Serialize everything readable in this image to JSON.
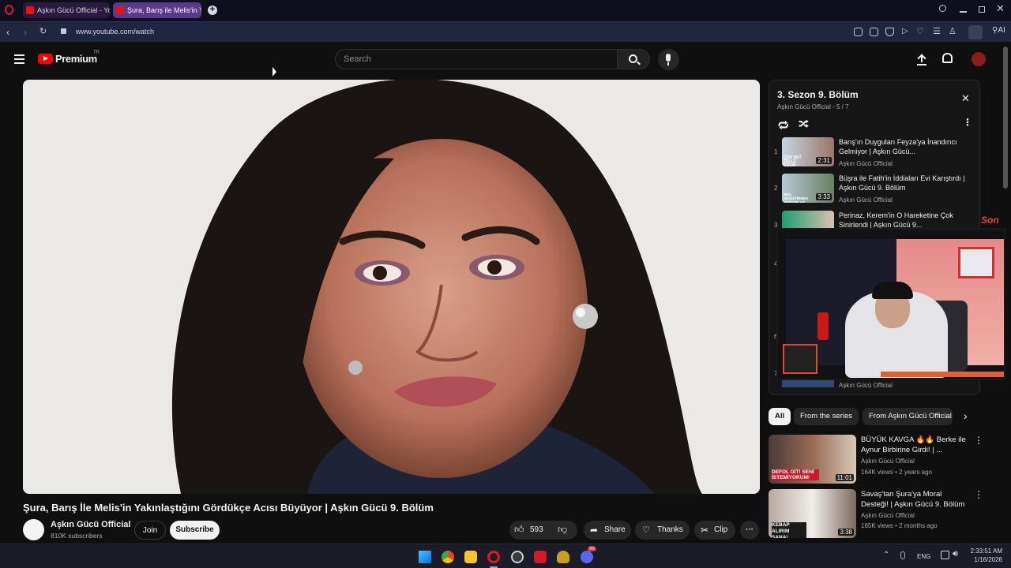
{
  "browser": {
    "tabs": [
      {
        "title": "Aşkın Gücü Official - YouT"
      },
      {
        "title": "Şura, Barış ile Melis'in Yakı"
      }
    ],
    "url": "www.youtube.com/watch",
    "ai_label": "AI"
  },
  "header": {
    "logo_text": "Premium",
    "region": "TR",
    "search_placeholder": "Search"
  },
  "video": {
    "title": "Şura, Barış İle Melis'in Yakınlaştığını Gördükçe Acısı Büyüyor | Aşkın Gücü 9. Bölüm",
    "channel": "Aşkın Gücü Official",
    "subscribers": "810K subscribers",
    "join_label": "Join",
    "subscribe_label": "Subscribe",
    "likes": "593",
    "share_label": "Share",
    "thanks_label": "Thanks",
    "clip_label": "Clip"
  },
  "playlist": {
    "title": "3. Sezon 9. Bölüm",
    "subtitle": "Aşkın Gücü Official - 5 / 7",
    "items": [
      {
        "num": "1",
        "title": "Barış'ın Duyguları Feyza'ya İnandırıcı Gelmiyor | Aşkın Gücü...",
        "channel": "Aşkın Gücü Official",
        "duration": "2:31",
        "thumb_text": "ÇOK NET ZELLE KALIN"
      },
      {
        "num": "2",
        "title": "Büşra ile Fatih'in İddiaları Evi Karıştırdı | Aşkın Gücü 9. Bölüm",
        "channel": "Aşkın Gücü Official",
        "duration": "3:33",
        "thumb_text": "BEN DEĞİŞTİRMEK İSTİYORLAR"
      },
      {
        "num": "3",
        "title": "Perinaz, Kerem'in O Hareketine Çok Sinirlendi | Aşkın Gücü 9...",
        "channel": "",
        "duration": "",
        "thumb_text": ""
      },
      {
        "num": "4",
        "title": "",
        "channel": "",
        "duration": "",
        "thumb_text": ""
      },
      {
        "num": "6",
        "title": "",
        "channel": "",
        "duration": "",
        "thumb_text": ""
      },
      {
        "num": "7",
        "title": "",
        "channel": "Aşkın Gücü Official",
        "duration": "",
        "thumb_text": ""
      }
    ]
  },
  "chips": [
    "All",
    "From the series",
    "From Aşkın Gücü Official"
  ],
  "recommendations": [
    {
      "title": "BÜYÜK KAVGA 🔥🔥 Berke ile Aynur Birbirine Girdi! | ...",
      "channel": "Aşkın Gücü Official",
      "stats": "164K views • 2 years ago",
      "duration": "11:01",
      "thumb_text": "DEFOL GİT! SENİ İSTEMİYORUM!"
    },
    {
      "title": "Savaş'tan Şura'ya Moral Desteği! | Aşkın Gücü 9. Bölüm",
      "channel": "Aşkın Gücü Official",
      "stats": "165K views • 2 months ago",
      "duration": "3:38",
      "thumb_text": "KEBAP ALIRIM SANA!"
    }
  ],
  "overlay": {
    "side_text": "Son"
  },
  "taskbar": {
    "lang": "ENG",
    "time": "2:33:51 AM",
    "date": "1/16/2026",
    "discord_badge": "99"
  }
}
